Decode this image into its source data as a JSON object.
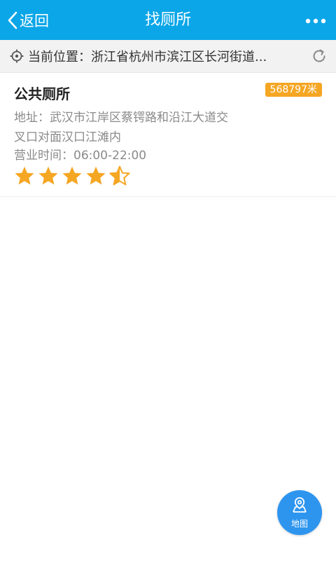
{
  "header": {
    "back_label": "返回",
    "title": "找厕所",
    "more_icon": "more-dots-icon"
  },
  "location": {
    "text": "当前位置：浙江省杭州市滨江区长河街道...",
    "icon": "locate-icon",
    "refresh_icon": "refresh-icon"
  },
  "results": [
    {
      "name": "公共厕所",
      "distance": "568797米",
      "address": "地址：武汉市江岸区蔡锷路和沿江大道交叉口对面汉口江滩内",
      "hours": "营业时间：06:00-22:00",
      "rating": 4.5,
      "rating_max": 5
    }
  ],
  "map_button": {
    "label": "地图",
    "icon": "map-pin-icon"
  },
  "colors": {
    "header_bg": "#0aa6e8",
    "badge_bg": "#f5a623",
    "star": "#f5a623",
    "fab_bg": "#2e95ef"
  }
}
